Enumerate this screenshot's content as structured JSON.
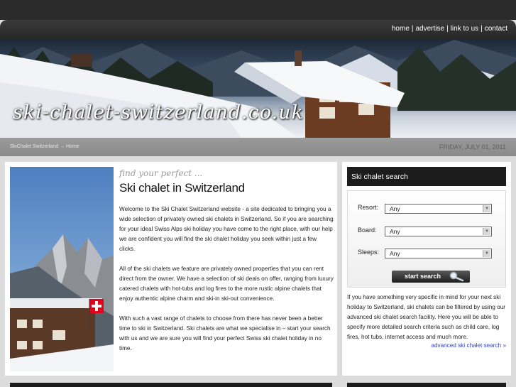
{
  "nav": {
    "links": [
      "home",
      "advertise",
      "link to us",
      "contact"
    ],
    "separator": "|"
  },
  "banner": {
    "site_title": "ski-chalet-switzerland.co.uk"
  },
  "breadcrumb": {
    "site": "SkiChalet Switzerland",
    "separator": "→",
    "current": "Home",
    "date": "FRIDAY, JULY 01, 2011"
  },
  "main": {
    "tagline": "find your perfect ...",
    "heading": "Ski chalet in Switzerland",
    "paragraphs": [
      "Welcome to the Ski Chalet Switzerland website - a site dedicated to bringing you a wide selection of privately owned ski chalets in Switzerland. So if you are searching for your ideal Swiss Alps ski holiday you have come to the right place, with our help we are confident you will find the ski chalet holiday you seek within just a few clicks.",
      "All of the ski chalets we feature are privately owned properties that you can rent direct from the owner. We have a selection of ski deals on offer, ranging from luxury catered chalets with hot-tubs and log fires to the more rustic alpine chalets that enjoy authentic alpine charm and ski-in ski-out convenience.",
      "With such a vast range of chalets to choose from there has never been a better time to ski in Switzerland. Ski chalets are what we specialise in – start your search with us and we are sure you will find your perfect Swiss ski chalet holiday in no time."
    ]
  },
  "sidebar": {
    "search_title": "Ski chalet search",
    "fields": [
      {
        "label": "Resort:",
        "value": "Any"
      },
      {
        "label": "Board:",
        "value": "Any"
      },
      {
        "label": "Sleeps:",
        "value": "Any"
      }
    ],
    "search_button": "start search",
    "info_text": "If you have something very specific in mind for your next ski holiday to Switzerland, ski chalets can be filtered by using our advanced ski chalet search facility. Here you will be able to specify more detailed search criteria such as child care, log fires, hot tubs, internet access and much more.",
    "advanced_link": "advanced ski chalet search »"
  },
  "colors": {
    "header_dark": "#2b2b2b",
    "panel_bg": "#ffffff",
    "page_bg": "#dcdcdc",
    "link_blue": "#2a3fc9",
    "swiss_red": "#e3001b"
  },
  "icons": {
    "search_button_icon": "magnifier-icon",
    "select_arrow": "chevron-down-icon"
  }
}
